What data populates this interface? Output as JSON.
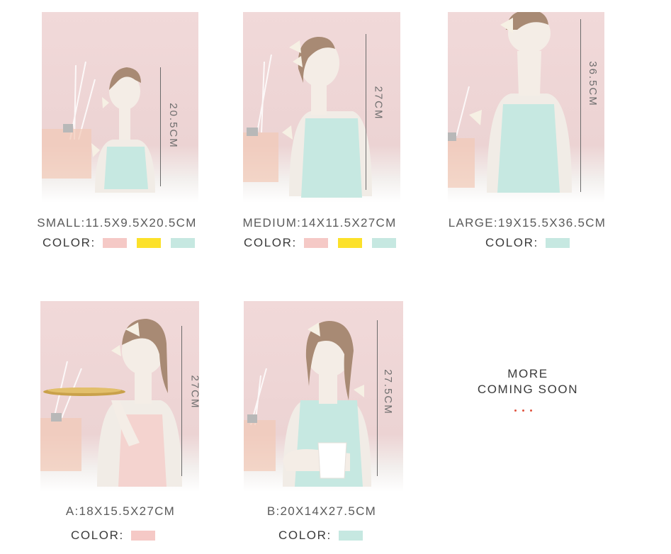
{
  "products": [
    {
      "size_label": "SMALL:11.5X9.5X20.5CM",
      "height_label": "20.5CM",
      "color_label": "COLOR:",
      "top_color": "#c6e8e1",
      "swatches": [
        "#f5c9c6",
        "#fce12a",
        "#c6e8e1"
      ]
    },
    {
      "size_label": "MEDIUM:14X11.5X27CM",
      "height_label": "27CM",
      "color_label": "COLOR:",
      "top_color": "#c6e8e1",
      "swatches": [
        "#f5c9c6",
        "#fce12a",
        "#c6e8e1"
      ]
    },
    {
      "size_label": "LARGE:19X15.5X36.5CM",
      "height_label": "36.5CM",
      "color_label": "COLOR:",
      "top_color": "#c6e8e1",
      "swatches": [
        "#c6e8e1"
      ]
    },
    {
      "size_label": "A:18X15.5X27CM",
      "height_label": "27CM",
      "color_label": "COLOR:",
      "top_color": "#f4d3cf",
      "swatches": [
        "#f5c9c6"
      ]
    },
    {
      "size_label": "B:20X14X27.5CM",
      "height_label": "27.5CM",
      "color_label": "COLOR:",
      "top_color": "#c6e8e1",
      "swatches": [
        "#c6e8e1"
      ]
    }
  ],
  "coming_soon": {
    "line1": "MORE",
    "line2": "COMING SOON"
  },
  "accent_color": "#e0533f"
}
